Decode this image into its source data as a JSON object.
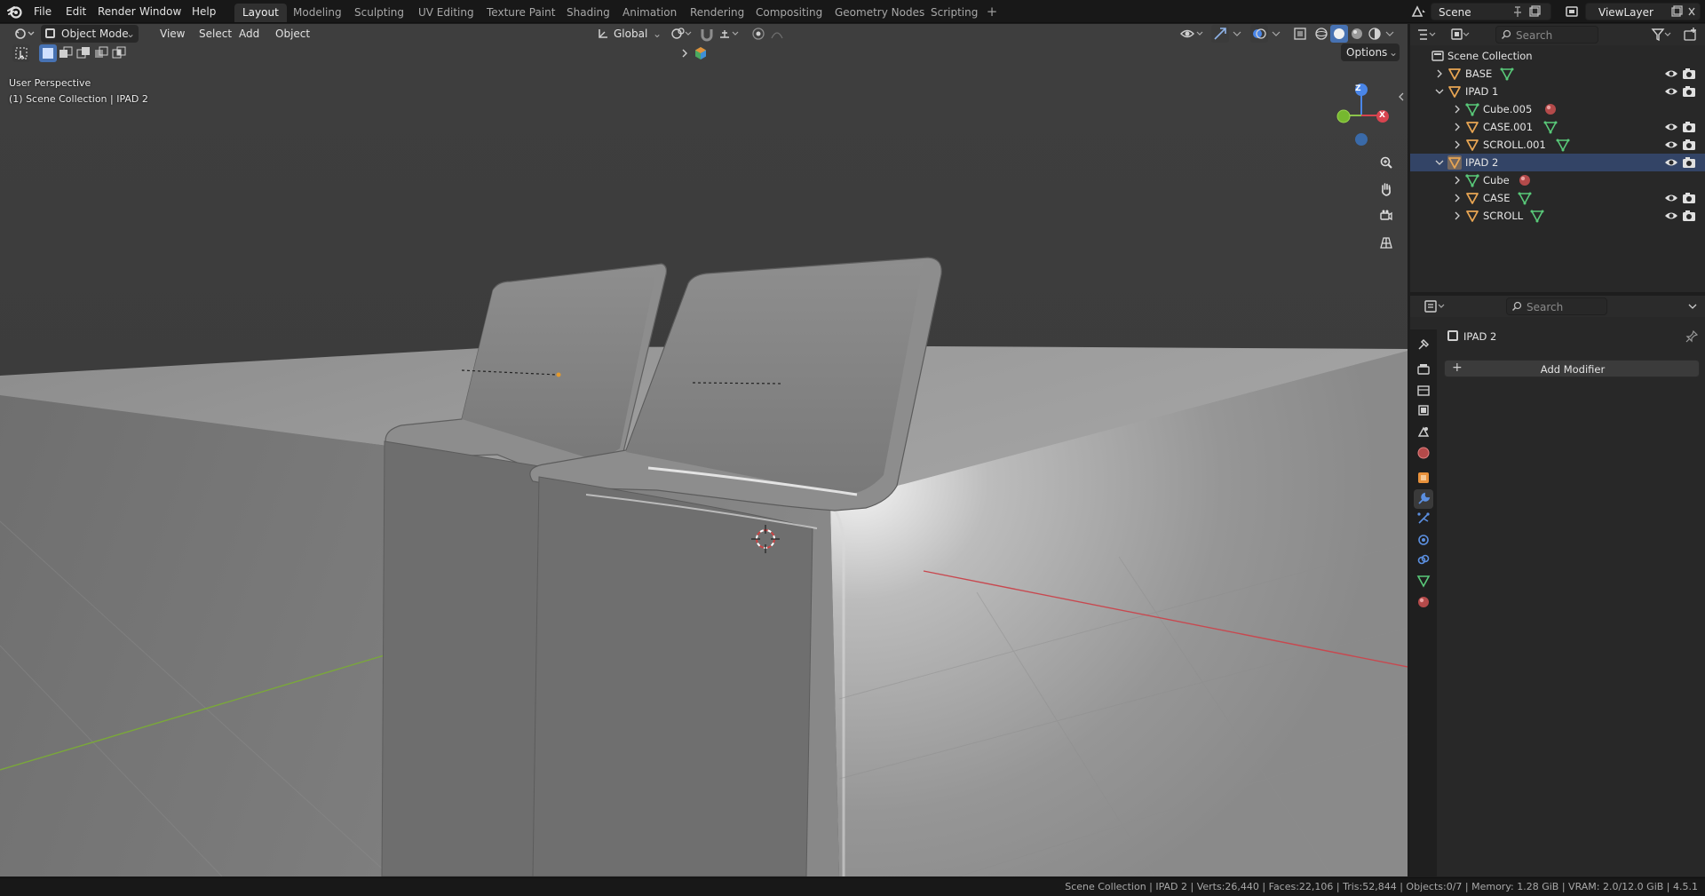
{
  "menus": [
    "File",
    "Edit",
    "Render",
    "Window",
    "Help"
  ],
  "workspace_tabs": [
    "Layout",
    "Modeling",
    "Sculpting",
    "UV Editing",
    "Texture Paint",
    "Shading",
    "Animation",
    "Rendering",
    "Compositing",
    "Geometry Nodes",
    "Scripting"
  ],
  "active_workspace": "Layout",
  "scene": {
    "label": "Scene",
    "view_layer": "ViewLayer"
  },
  "viewport": {
    "mode": "Object Mode",
    "menus": [
      "View",
      "Select",
      "Add",
      "Object"
    ],
    "transform_orientation": "Global",
    "options_label": "Options",
    "view_name": "User Perspective",
    "collection_info": "(1) Scene Collection | IPAD 2",
    "gizmo_axes": {
      "z": "Z",
      "x": "X"
    }
  },
  "outliner": {
    "search_placeholder": "Search",
    "root": "Scene Collection",
    "items": [
      {
        "name": "BASE",
        "depth": 0,
        "expanded": false,
        "type": "empty",
        "data_icon": "mesh-data-icon",
        "visible": true
      },
      {
        "name": "IPAD 1",
        "depth": 0,
        "expanded": true,
        "type": "empty",
        "data_icon": "",
        "visible": true
      },
      {
        "name": "Cube.005",
        "depth": 1,
        "expanded": false,
        "type": "mesh",
        "data_icon": "material-icon",
        "visible": false
      },
      {
        "name": "CASE.001",
        "depth": 1,
        "expanded": false,
        "type": "empty",
        "data_icon": "mesh-data-icon",
        "visible": true
      },
      {
        "name": "SCROLL.001",
        "depth": 1,
        "expanded": false,
        "type": "empty",
        "data_icon": "mesh-data-icon",
        "visible": true
      },
      {
        "name": "IPAD 2",
        "depth": 0,
        "expanded": true,
        "type": "empty-selected",
        "data_icon": "",
        "visible": true
      },
      {
        "name": "Cube",
        "depth": 1,
        "expanded": false,
        "type": "mesh",
        "data_icon": "material-icon",
        "visible": false
      },
      {
        "name": "CASE",
        "depth": 1,
        "expanded": false,
        "type": "empty",
        "data_icon": "mesh-data-icon",
        "visible": true
      },
      {
        "name": "SCROLL",
        "depth": 1,
        "expanded": false,
        "type": "empty",
        "data_icon": "mesh-data-icon",
        "visible": true
      }
    ]
  },
  "properties": {
    "search_placeholder": "Search",
    "object_name": "IPAD 2",
    "add_modifier_label": "Add Modifier",
    "tabs": [
      "tool-icon",
      "render-icon",
      "output-icon",
      "view-layer-icon",
      "scene-icon",
      "world-icon",
      "object-icon",
      "modifier-icon",
      "particles-icon",
      "physics-icon",
      "constraints-icon",
      "data-icon",
      "material-icon"
    ],
    "active_tab": "modifier-icon"
  },
  "status": {
    "text": "Scene Collection | IPAD 2 | Verts:26,440 | Faces:22,106 | Tris:52,844 | Objects:0/7 | Memory: 1.28 GiB | VRAM: 2.0/12.0 GiB | 4.5.1"
  },
  "colors": {
    "accent": "#4772b3",
    "empty_icon": "#e8a553",
    "mesh_icon": "#59c979",
    "axis_x": "#d8444f",
    "axis_y": "#8bc34a",
    "axis_z": "#4a86e8"
  }
}
